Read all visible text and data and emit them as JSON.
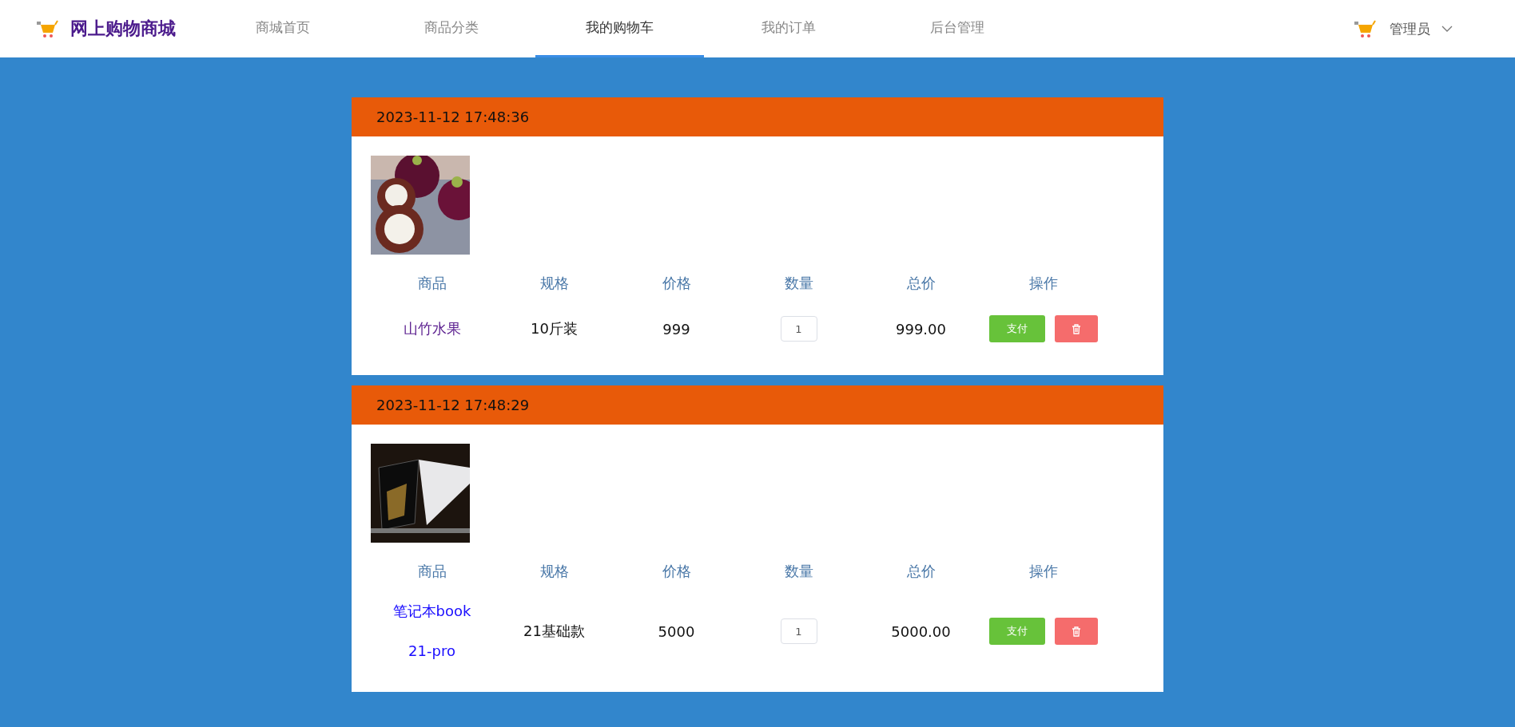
{
  "header": {
    "title": "网上购物商城",
    "nav": [
      {
        "label": "商城首页",
        "selected": false
      },
      {
        "label": "商品分类",
        "selected": false
      },
      {
        "label": "我的购物车",
        "selected": true
      },
      {
        "label": "我的订单",
        "selected": false
      },
      {
        "label": "后台管理",
        "selected": false
      }
    ],
    "user": "管理员"
  },
  "orders": [
    {
      "time": "2023-11-12 17:48:36",
      "kind": "fruit",
      "columns": [
        "商品",
        "规格",
        "价格",
        "数量",
        "总价",
        "操作"
      ],
      "name_lines": [
        "山竹水果"
      ],
      "visited": true,
      "spec": "10斤装",
      "price": "999",
      "quantity": "1",
      "total": "999.00",
      "pay": "支付"
    },
    {
      "time": "2023-11-12 17:48:29",
      "kind": "laptop",
      "columns": [
        "商品",
        "规格",
        "价格",
        "数量",
        "总价",
        "操作"
      ],
      "name_lines": [
        "笔记本book",
        "21-pro"
      ],
      "visited": false,
      "spec": "21基础款",
      "price": "5000",
      "quantity": "1",
      "total": "5000.00",
      "pay": "支付"
    }
  ]
}
